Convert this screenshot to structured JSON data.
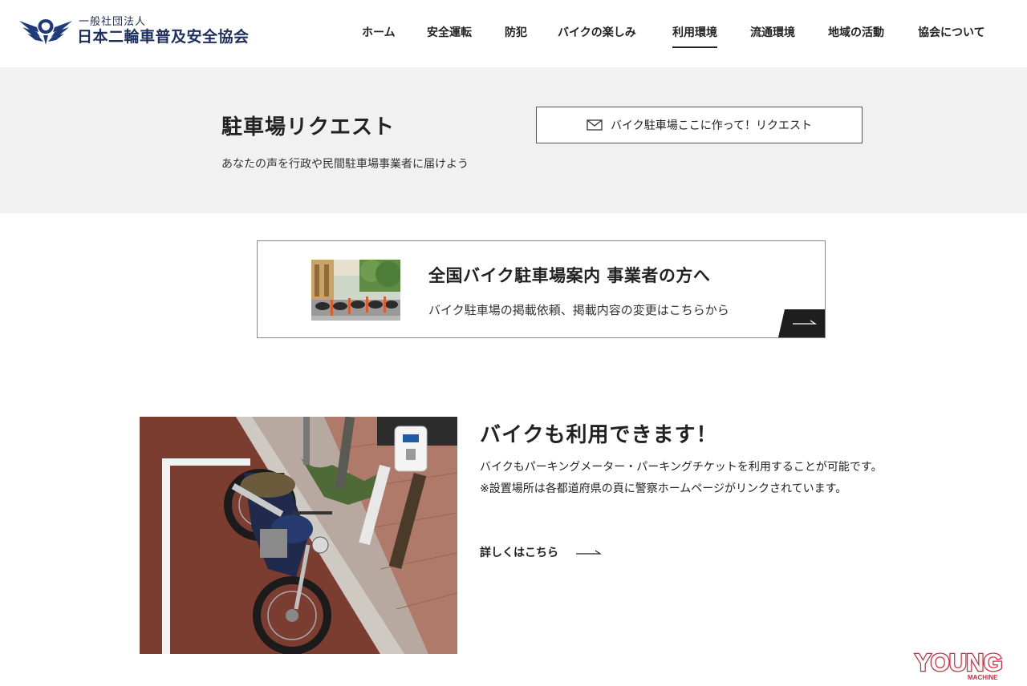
{
  "header": {
    "org_sub": "一般社団法人",
    "org_name": "日本二輪車普及安全協会",
    "nav": [
      {
        "label": "ホーム",
        "active": false
      },
      {
        "label": "安全運転",
        "active": false
      },
      {
        "label": "防犯",
        "active": false
      },
      {
        "label": "バイクの楽しみ",
        "active": false
      },
      {
        "label": "利用環境",
        "active": true
      },
      {
        "label": "流通環境",
        "active": false
      },
      {
        "label": "地域の活動",
        "active": false
      },
      {
        "label": "協会について",
        "active": false
      }
    ]
  },
  "request": {
    "title": "駐車場リクエスト",
    "description": "あなたの声を行政や民間駐車場事業者に届けよう",
    "button_label": "バイク駐車場ここに作って！リクエスト",
    "button_icon": "mail-icon"
  },
  "business": {
    "title": "全国バイク駐車場案内 事業者の方へ",
    "description": "バイク駐車場の掲載依頼、掲載内容の変更はこちらから",
    "arrow_icon": "arrow-right-icon"
  },
  "meter": {
    "title": "バイクも利用できます！",
    "body_line1": "バイクもパーキングメーター・パーキングチケットを利用することが可能です。",
    "body_line2": "※設置場所は各都道府県の頁に警察ホームページがリンクされています。",
    "more_label": "詳しくはこちら"
  },
  "watermark": {
    "text": "YOUNG",
    "subtext": "ヤングマシン MACHINE"
  },
  "colors": {
    "brand_navy": "#1c2f5e",
    "band_gray": "#f1f1f1",
    "arrow_dark": "#1e1e1e",
    "watermark_red": "#d9263a"
  }
}
